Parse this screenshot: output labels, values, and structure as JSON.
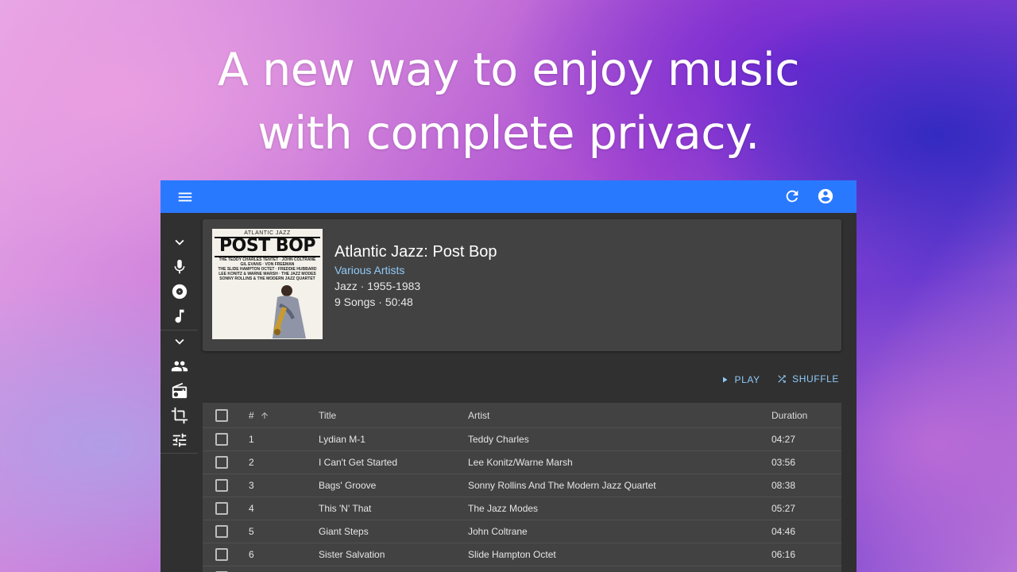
{
  "headline": {
    "line1": "A new way to enjoy music",
    "line2": "with complete privacy."
  },
  "appbar": {
    "icons": [
      "menu-icon",
      "refresh-icon",
      "account-circle-icon"
    ],
    "color": "#2979ff"
  },
  "sidebar": {
    "icons": [
      "chevron-down-icon",
      "microphone-icon",
      "album-disc-icon",
      "music-note-icon",
      "chevron-down-icon",
      "people-icon",
      "radio-icon",
      "crop-icon",
      "tune-icon"
    ]
  },
  "album": {
    "title": "Atlantic Jazz: Post Bop",
    "artist": "Various Artists",
    "genre_years": "Jazz · 1955-1983",
    "songs_duration": "9 Songs · 50:48",
    "cover": {
      "brand": "ATLANTIC JAZZ",
      "title": "POST BOP",
      "names": [
        "THE TEDDY CHARLES TENTET · JOHN COLTRANE",
        "GIL EVANS · VON FREEMAN",
        "THE SLIDE HAMPTON OCTET · FREDDIE HUBBARD",
        "LEE KONITZ & WARNE MARSH · THE JAZZ MODES",
        "SONNY ROLLINS & THE MODERN JAZZ QUARTET"
      ]
    }
  },
  "actions": {
    "play": "PLAY",
    "shuffle": "SHUFFLE",
    "accent": "#90caf9"
  },
  "table": {
    "headers": {
      "num": "#",
      "title": "Title",
      "artist": "Artist",
      "duration": "Duration"
    },
    "rows": [
      {
        "num": "1",
        "title": "Lydian M-1",
        "artist": "Teddy Charles",
        "duration": "04:27"
      },
      {
        "num": "2",
        "title": "I Can't Get Started",
        "artist": "Lee Konitz/Warne Marsh",
        "duration": "03:56"
      },
      {
        "num": "3",
        "title": "Bags' Groove",
        "artist": "Sonny Rollins And The Modern Jazz Quartet",
        "duration": "08:38"
      },
      {
        "num": "4",
        "title": "This 'N' That",
        "artist": "The Jazz Modes",
        "duration": "05:27"
      },
      {
        "num": "5",
        "title": "Giant Steps",
        "artist": "John Coltrane",
        "duration": "04:46"
      },
      {
        "num": "6",
        "title": "Sister Salvation",
        "artist": "Slide Hampton Octet",
        "duration": "06:16"
      }
    ]
  }
}
